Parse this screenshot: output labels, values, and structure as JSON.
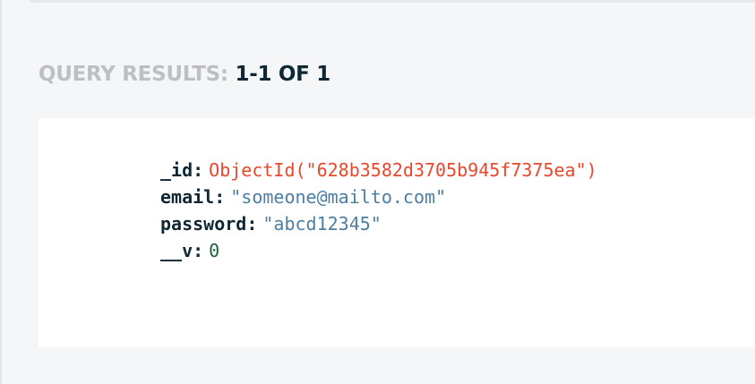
{
  "results_header": {
    "label": "QUERY RESULTS:",
    "count": "1-1 OF 1"
  },
  "document": {
    "fields": [
      {
        "key": "_id",
        "value": "ObjectId(\"628b3582d3705b945f7375ea\")",
        "type": "objectid"
      },
      {
        "key": "email",
        "value": "\"someone@mailto.com\"",
        "type": "string"
      },
      {
        "key": "password",
        "value": "\"abcd12345\"",
        "type": "string"
      },
      {
        "key": "__v",
        "value": "0",
        "type": "number"
      }
    ]
  },
  "colors": {
    "objectid": "#e8492c",
    "string": "#4c7ea2",
    "number": "#1e5e3a",
    "key": "#0f2733",
    "header_label": "#bcc0c3"
  }
}
